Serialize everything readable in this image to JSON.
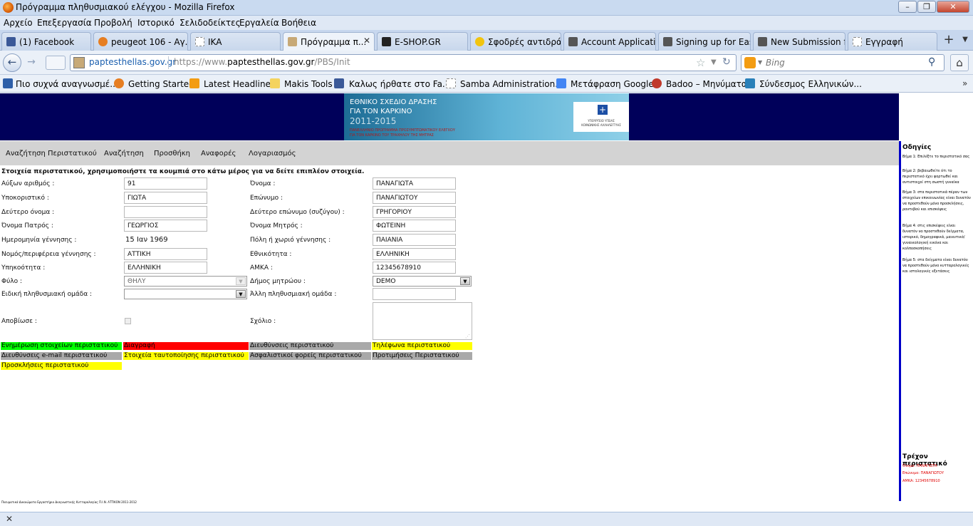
{
  "window": {
    "title": "Πρόγραμμα πληθυσμιακού ελέγχου - Mozilla Firefox"
  },
  "menu": [
    "Αρχείο",
    "Επεξεργασία",
    "Προβολή",
    "Ιστορικό",
    "Σελιδοδείκτες",
    "Εργαλεία",
    "Βοήθεια"
  ],
  "tabs": [
    {
      "label": "(1) Facebook",
      "color": "#3b5998"
    },
    {
      "label": "peugeot 106 - Αγ...",
      "color": "#e67e22"
    },
    {
      "label": "IKA",
      "color": "#ffffff"
    },
    {
      "label": "Πρόγραμμα π...",
      "color": "#8b6f47"
    },
    {
      "label": "E-SHOP.GR",
      "color": "#222222"
    },
    {
      "label": "Σφοδρές αντιδρά...",
      "color": "#f1c40f"
    },
    {
      "label": "Account Applicati...",
      "color": "#444444"
    },
    {
      "label": "Signing up for Eas...",
      "color": "#444444"
    },
    {
      "label": "New Submission f...",
      "color": "#444444"
    },
    {
      "label": "Εγγραφή",
      "color": "#ffffff"
    }
  ],
  "nav": {
    "domain": "paptesthellas.gov.gr",
    "url_prefix": "https://www.",
    "url_domain": "paptesthellas.gov.gr",
    "url_path": "/PBS/Init",
    "search_placeholder": "Bing"
  },
  "bookmarks": [
    {
      "label": "Πιο συχνά αναγνωσμέ...",
      "color": "#2e5fa8"
    },
    {
      "label": "Getting Started",
      "color": "#e67e22"
    },
    {
      "label": "Latest Headlines",
      "color": "#f39c12"
    },
    {
      "label": "Makis Tools",
      "color": "#f4d35e"
    },
    {
      "label": "Καλως ήρθατε στο Fa...",
      "color": "#3b5998"
    },
    {
      "label": "Samba Administration...",
      "color": "#ffffff"
    },
    {
      "label": "Μετάφραση Google",
      "color": "#4285f4"
    },
    {
      "label": "Badoo – Μηνύματα",
      "color": "#c0392b"
    },
    {
      "label": "Σύνδεσμος Ελληνικών...",
      "color": "#2980b9"
    }
  ],
  "banner": {
    "line1": "ΕΘΝΙΚΟ ΣΧΕΔΙΟ ΔΡΑΣΗΣ",
    "line2": "ΓΙΑ ΤΟΝ ΚΑΡΚΙΝΟ",
    "years": "2011-2015",
    "sub1": "ΠΑΝΕΛΛΗΝΙΟ ΠΡΟΓΡΑΜΜΑ ΠΡΟΣΥΜΠΤΩΜΑΤΙΚΟΥ ΕΛΕΓΧΟΥ",
    "sub2": "ΓΙΑ ΤΟΝ ΚΑΡΚΙΝΟ ΤΟΥ ΤΡΑΧΗΛΟΥ ΤΗΣ ΜΗΤΡΑΣ",
    "ministry1": "ΥΠΟΥΡΓΕΙΟ ΥΓΕΙΑΣ",
    "ministry2": "ΚΟΙΝΩΝΙΚΗΣ ΑΛΛΗΛΕΓΓΥΗΣ"
  },
  "navmenu": [
    "Αναζήτηση Περιστατικού",
    "Αναζήτηση",
    "Προσθήκη",
    "Αναφορές",
    "Λογαριασμός"
  ],
  "intro": "Στοιχεία περιστατικού, χρησιμοποιήστε τα κουμπιά στο κάτω μέρος για να δείτε επιπλέον στοιχεία.",
  "form": {
    "aa_label": "Αύξων αριθμός :",
    "aa_value": "91",
    "onoma_label": "Όνομα :",
    "onoma_value": "ΠΑΝΑΓΙΩΤΑ",
    "hypo_label": "Υποκοριστικό :",
    "hypo_value": "ΓΙΩΤΑ",
    "epon_label": "Επώνυμο :",
    "epon_value": "ΠΑΝΑΓΙΩΤΟΥ",
    "deut_label": "Δεύτερο όνομα :",
    "deut_value": "",
    "deutep_label": "Δεύτερο επώνυμο (συζύγου) :",
    "deutep_value": "ΓΡΗΓΟΡΙΟΥ",
    "pat_label": "Όνομα Πατρός :",
    "pat_value": "ΓΕΩΡΓΙΟΣ",
    "mit_label": "Όνομα Μητρός :",
    "mit_value": "ΦΩΤΕΙΝΗ",
    "birth_label": "Ημερομηνία γέννησης :",
    "birth_value": "15 Ιαν 1969",
    "poli_label": "Πόλη ή χωριό γέννησης :",
    "poli_value": "ΠΑΙΑΝΙΑ",
    "nomos_label": "Νομός/περιφέρεια γέννησης :",
    "nomos_value": "ΑΤΤΙΚΗ",
    "ethn_label": "Εθνικότητα :",
    "ethn_value": "ΕΛΛΗΝΙΚΗ",
    "ypik_label": "Υπηκοότητα :",
    "ypik_value": "ΕΛΛΗΝΙΚΗ",
    "amka_label": "ΑΜΚΑ :",
    "amka_value": "12345678910",
    "fylo_label": "Φύλο :",
    "fylo_value": "ΘΗΛΥ",
    "dimos_label": "Δήμος μητρώου :",
    "dimos_value": "DEMO",
    "eidiki_label": "Ειδική πληθυσμιακή ομάδα :",
    "eidiki_value": "",
    "alli_label": "Άλλη πληθυσμιακή ομάδα :",
    "alli_value": "",
    "apobiose_label": "Αποβίωσε :",
    "sxolio_label": "Σχόλιο :"
  },
  "buttons": [
    {
      "label": "Ενημέρωση στοιχείων περιστατικού",
      "bg": "#00ff00"
    },
    {
      "label": "Διαγραφή",
      "bg": "#ff0000"
    },
    {
      "label": "Διευθύνσεις περιστατικού",
      "bg": "#a9a9a9"
    },
    {
      "label": "Τηλέφωνα περιστατικού",
      "bg": "#ffff00"
    },
    {
      "label": "Διευθύνσεις e-mail περιστατικού",
      "bg": "#a9a9a9"
    },
    {
      "label": "Στοιχεία ταυτοποίησης περιστατικού",
      "bg": "#ffff00"
    },
    {
      "label": "Ασφαλιστικοί φορείς περιστατικού",
      "bg": "#a9a9a9"
    },
    {
      "label": "Προτιμήσεις Περιστατικού",
      "bg": "#a9a9a9"
    },
    {
      "label": "Προσκλήσεις περιστατικού",
      "bg": "#ffff00"
    }
  ],
  "sidebar": {
    "title": "Οδηγίες",
    "steps": [
      "Βήμα 1: Επιλέξτε το περιστατικό σας",
      "Βήμα 2: βεβαιωθείτε ότι το περιστατικό έχει φορτωθεί και αντιστοιχεί στη σωστή γυναίκα",
      "Βήμα 3: στα περιστατικά πέραν των στοιχείων επικοινωνίας είναι δυνατόν να προστεθούν μόνο προσκλήσεις, ραντεβού και επισκέψεις",
      "Βήμα 4: στις επισκέψεις είναι δυνατόν να προστεθούν δείγματα, ιστορικό, δημογραφικά, μαιευτικό/γυναικολογική εικόνα και κολποσκοπήσεις",
      "Βήμα 5: στα δείγματα είναι δυνατόν να προστεθούν μόνο κυτταρολογικές και ιστολογικές εξετάσεις"
    ],
    "current_title": "Τρέχον περιστατικό",
    "current_name": "Όνομα: ΠΑΝΑΓΙΩΤΑ",
    "current_surname": "Επώνυμο: ΠΑΝΑΓΙΩΤΟΥ",
    "current_amka": "ΑΜΚΑ: 12345678910"
  },
  "footer": "Πνευματικά Δικαιώματα Εργαστήριο Διαγνωστικής Κυτταρολογίας Π.Ι.Ν. ΑΤΤΙΚΟΝ 2011-2012"
}
